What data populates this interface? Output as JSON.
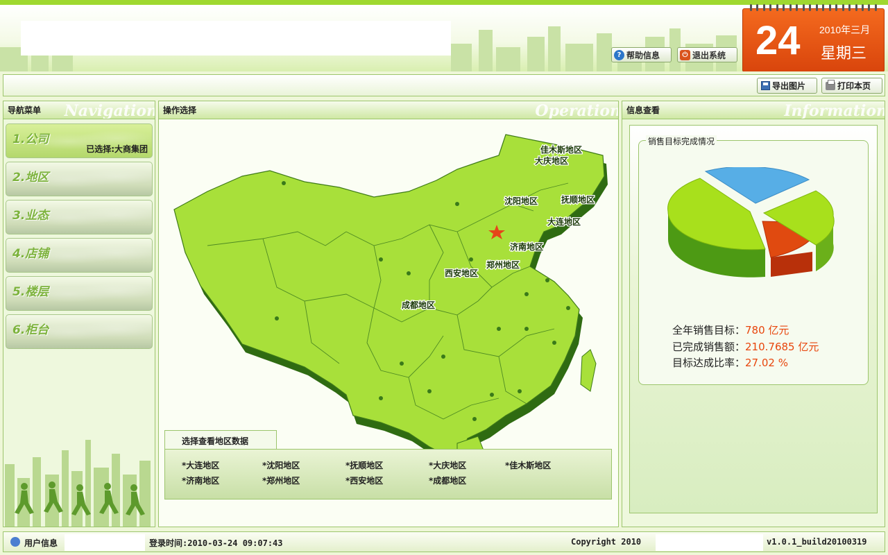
{
  "header": {
    "help_label": "帮助信息",
    "exit_label": "退出系统",
    "calendar": {
      "day": "24",
      "year_month": "2010年三月",
      "weekday": "星期三"
    }
  },
  "toolbar": {
    "export_label": "导出图片",
    "print_label": "打印本页"
  },
  "nav": {
    "title": "导航菜单",
    "watermark": "Navigation",
    "items": [
      {
        "label": "1.公司",
        "selected": "已选择:大商集团"
      },
      {
        "label": "2.地区"
      },
      {
        "label": "3.业态"
      },
      {
        "label": "4.店铺"
      },
      {
        "label": "5.楼层"
      },
      {
        "label": "6.柜台"
      }
    ]
  },
  "operation": {
    "title": "操作选择",
    "watermark": "Operation",
    "map_labels": [
      "佳木斯地区",
      "大庆地区",
      "沈阳地区",
      "抚顺地区",
      "大连地区",
      "济南地区",
      "郑州地区",
      "西安地区",
      "成都地区"
    ],
    "region_tab": "选择查看地区数据",
    "region_links": [
      "*大连地区",
      "*沈阳地区",
      "*抚顺地区",
      "*大庆地区",
      "*佳木斯地区",
      "*济南地区",
      "*郑州地区",
      "*西安地区",
      "*成都地区"
    ]
  },
  "info": {
    "title": "信息查看",
    "watermark": "Information",
    "fieldset_legend": "销售目标完成情况",
    "stats": [
      {
        "label": "全年销售目标：",
        "value": "780 亿元"
      },
      {
        "label": "已完成销售额：",
        "value": "210.7685 亿元"
      },
      {
        "label": "目标达成比率：",
        "value": "27.02 %"
      }
    ],
    "chart_colors": {
      "completed": "#57aee6",
      "red_segment": "#e04a10",
      "remaining": "#a8e01c"
    }
  },
  "status": {
    "user_label": "用户信息",
    "login_time": "登录时间:2010-03-24 09:07:43",
    "copyright": "Copyright 2010",
    "version": "v1.0.1_build20100319"
  }
}
